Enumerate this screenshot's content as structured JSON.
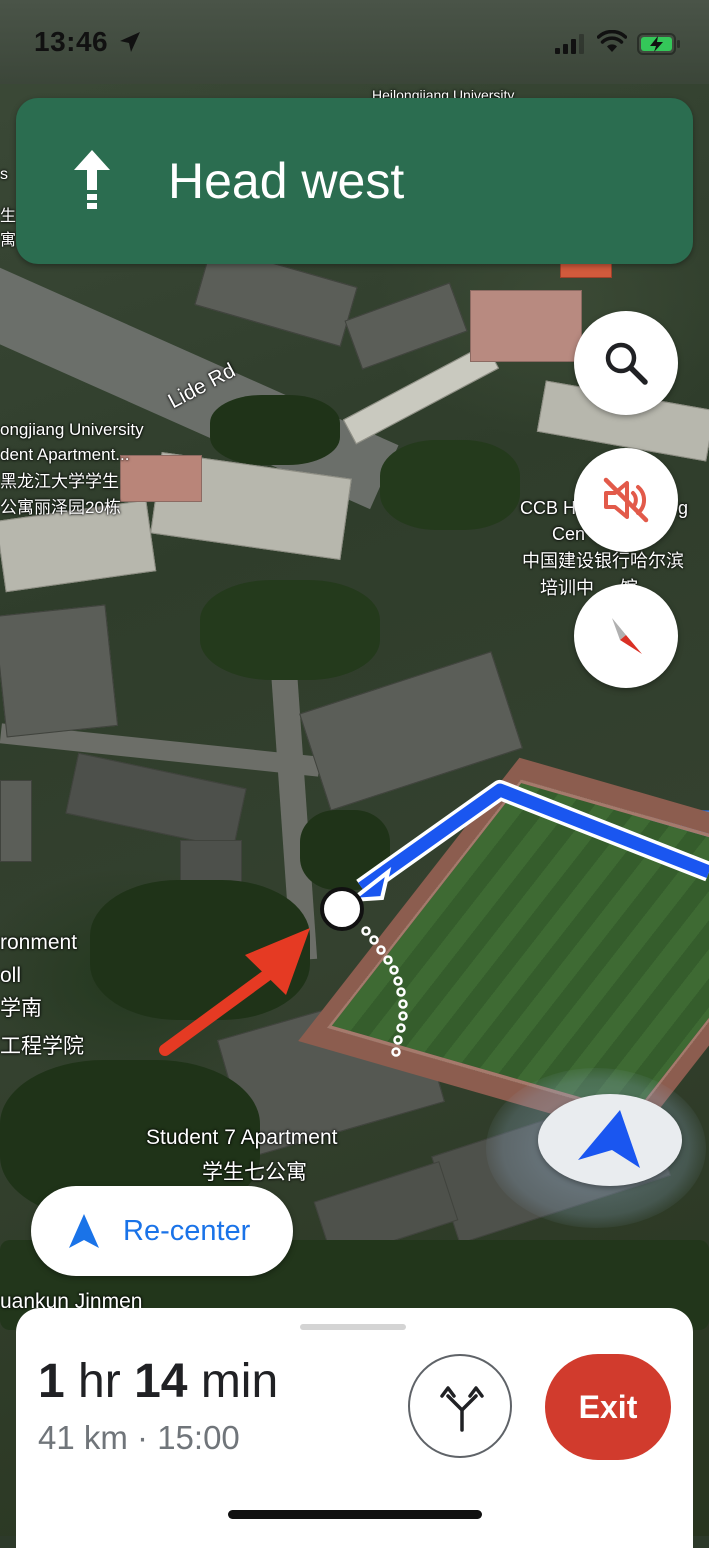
{
  "status_bar": {
    "time": "13:46"
  },
  "banner": {
    "instruction": "Head west",
    "color": "#2b6d50",
    "icon": "straight-arrow-icon"
  },
  "map_buttons": {
    "search_icon": "search-icon",
    "mute_icon": "volume-muted-icon",
    "compass_icon": "compass-icon"
  },
  "map_labels": {
    "top_university": "Heilongjiang University",
    "road": "Lide Rd",
    "apartment_en_1": "ongjiang University",
    "apartment_en_2": "dent Apartment...",
    "apartment_zh_1": "黑龙江大学学生",
    "apartment_zh_2": "公寓丽泽园20栋",
    "ccb_en_1": "CCB H",
    "ccb_en_2": "g",
    "ccb_en_3": "Cen",
    "ccb_zh_1": "中国建设银行哈尔滨",
    "ccb_zh_2": "培训中",
    "ccb_zh_3": "馆",
    "env_1": "ronment",
    "env_2": "oll",
    "env_3": "学南",
    "env_4": "工程学院",
    "student7_en": "Student 7 Apartment",
    "student7_zh": "学生七公寓",
    "bottom_left": "uankun Jinmen",
    "left_edge_1": "s",
    "left_edge_2": "生",
    "left_edge_3": "寓"
  },
  "recenter": {
    "label": "Re-center",
    "accent": "#1a73e8"
  },
  "bottom_sheet": {
    "eta_hours": "1",
    "eta_hours_unit": "hr",
    "eta_minutes": "14",
    "eta_minutes_unit": "min",
    "trip_info": "41 km · 15:00",
    "alt_routes_icon": "alternate-routes-icon",
    "exit_label": "Exit",
    "exit_color": "#d13b2d"
  },
  "route_color": "#1a56f0",
  "annotation_arrow_color": "#e53a23"
}
